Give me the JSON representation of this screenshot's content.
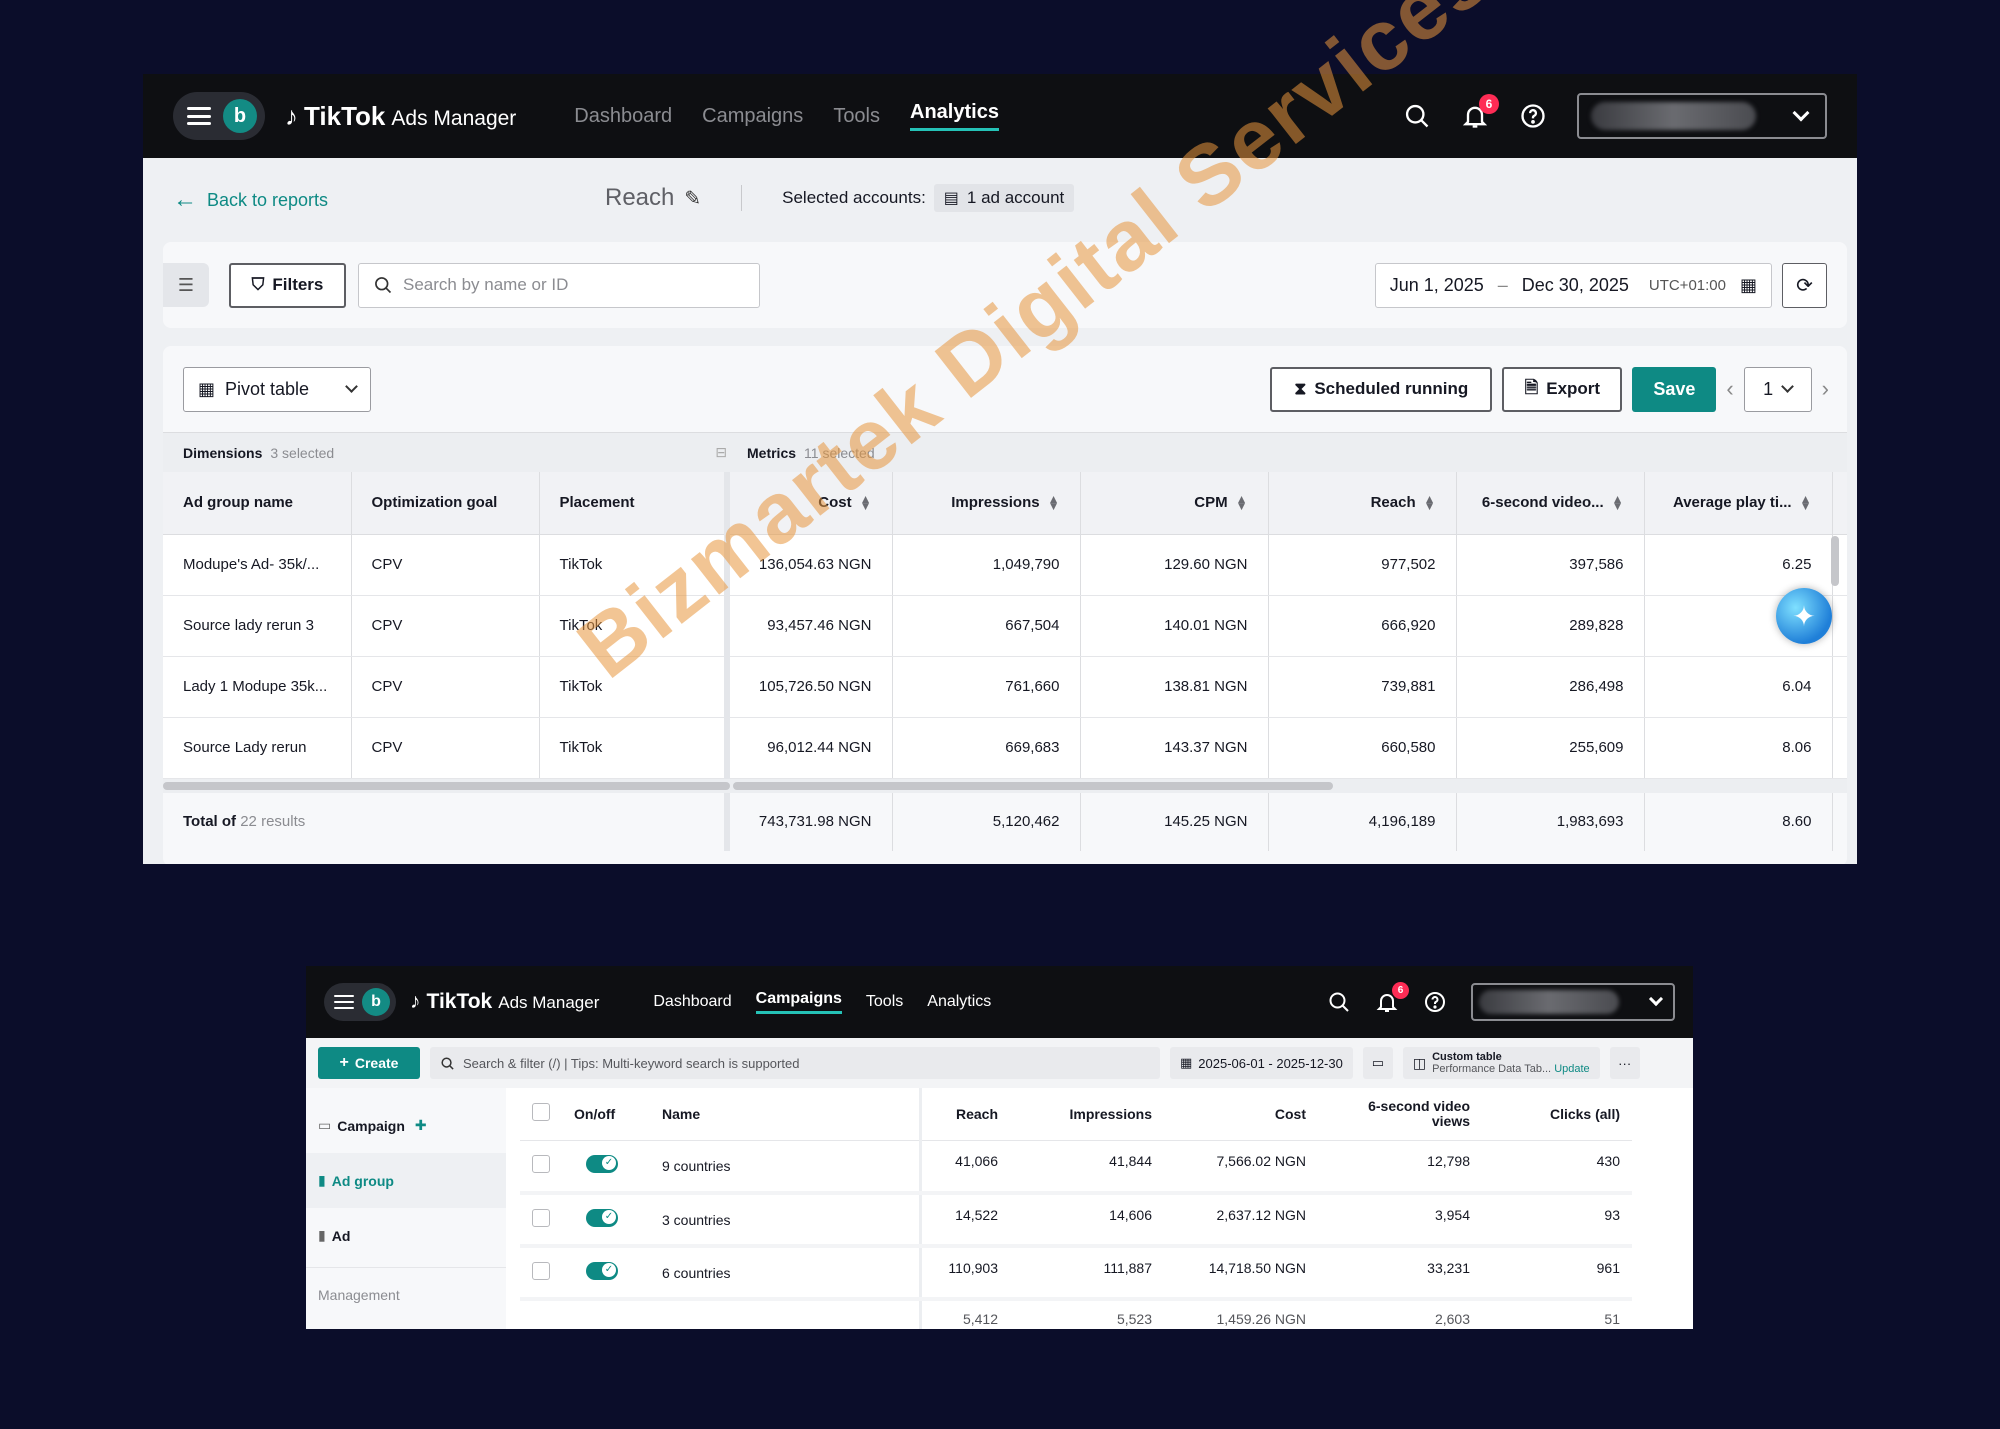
{
  "panel1": {
    "header": {
      "avatar_letter": "b",
      "logo_brand": "TikTok",
      "logo_sub": "Ads Manager",
      "nav": [
        "Dashboard",
        "Campaigns",
        "Tools",
        "Analytics"
      ],
      "active_nav": "Analytics",
      "notification_count": "6"
    },
    "subheader": {
      "back_label": "Back to reports",
      "report_title": "Reach",
      "selected_accounts_label": "Selected accounts:",
      "selected_accounts_value": "1 ad account"
    },
    "filterbar": {
      "filters_label": "Filters",
      "search_placeholder": "Search by name or ID",
      "date_start": "Jun 1, 2025",
      "date_sep": "–",
      "date_end": "Dec 30, 2025",
      "timezone": "UTC+01:00"
    },
    "toolbar": {
      "view_select": "Pivot table",
      "scheduled_label": "Scheduled running",
      "export_label": "Export",
      "save_label": "Save",
      "page_value": "1"
    },
    "table": {
      "dimensions_label": "Dimensions",
      "dimensions_count": "3 selected",
      "metrics_label": "Metrics",
      "metrics_count": "11 selected",
      "columns": [
        "Ad group name",
        "Optimization goal",
        "Placement",
        "Cost",
        "Impressions",
        "CPM",
        "Reach",
        "6-second video...",
        "Average play ti..."
      ],
      "rows": [
        [
          "Modupe's Ad- 35k/...",
          "CPV",
          "TikTok",
          "136,054.63 NGN",
          "1,049,790",
          "129.60 NGN",
          "977,502",
          "397,586",
          "6.25"
        ],
        [
          "Source lady rerun 3",
          "CPV",
          "TikTok",
          "93,457.46 NGN",
          "667,504",
          "140.01 NGN",
          "666,920",
          "289,828",
          "8."
        ],
        [
          "Lady 1 Modupe 35k...",
          "CPV",
          "TikTok",
          "105,726.50 NGN",
          "761,660",
          "138.81 NGN",
          "739,881",
          "286,498",
          "6.04"
        ],
        [
          "Source Lady rerun",
          "CPV",
          "TikTok",
          "96,012.44 NGN",
          "669,683",
          "143.37 NGN",
          "660,580",
          "255,609",
          "8.06"
        ]
      ],
      "total_label": "Total of",
      "total_count": "22 results",
      "totals": [
        "743,731.98 NGN",
        "5,120,462",
        "145.25 NGN",
        "4,196,189",
        "1,983,693",
        "8.60"
      ]
    }
  },
  "watermark": "Bizmartek Digital Services",
  "panel2": {
    "header": {
      "avatar_letter": "b",
      "logo_brand": "TikTok",
      "logo_sub": "Ads Manager",
      "nav": [
        "Dashboard",
        "Campaigns",
        "Tools",
        "Analytics"
      ],
      "active_nav": "Campaigns",
      "notification_count": "6"
    },
    "toolbar": {
      "create_label": "Create",
      "search_placeholder": "Search & filter (/) | Tips: Multi-keyword search is supported",
      "date_range": "2025-06-01 - 2025-12-30",
      "custom_table_title": "Custom table",
      "custom_table_sub": "Performance Data Tab...",
      "update_label": "Update",
      "more_label": "···"
    },
    "sidebar": {
      "campaign": "Campaign",
      "ad_group": "Ad group",
      "ad": "Ad",
      "management": "Management"
    },
    "table": {
      "columns": [
        "On/off",
        "Name",
        "Reach",
        "Impressions",
        "Cost",
        "6-second video views",
        "Clicks (all)"
      ],
      "rows": [
        [
          "9 countries",
          "41,066",
          "41,844",
          "7,566.02 NGN",
          "12,798",
          "430"
        ],
        [
          "3 countries",
          "14,522",
          "14,606",
          "2,637.12 NGN",
          "3,954",
          "93"
        ],
        [
          "6 countries",
          "110,903",
          "111,887",
          "14,718.50 NGN",
          "33,231",
          "961"
        ]
      ],
      "partial_row": [
        "5,412",
        "5,523",
        "1,459.26 NGN",
        "2,603",
        "51"
      ]
    }
  },
  "colors": {
    "background": "#0b0d2a",
    "accent": "#0e8a84",
    "notification": "#fe2c55",
    "watermark": "#e8963c"
  }
}
